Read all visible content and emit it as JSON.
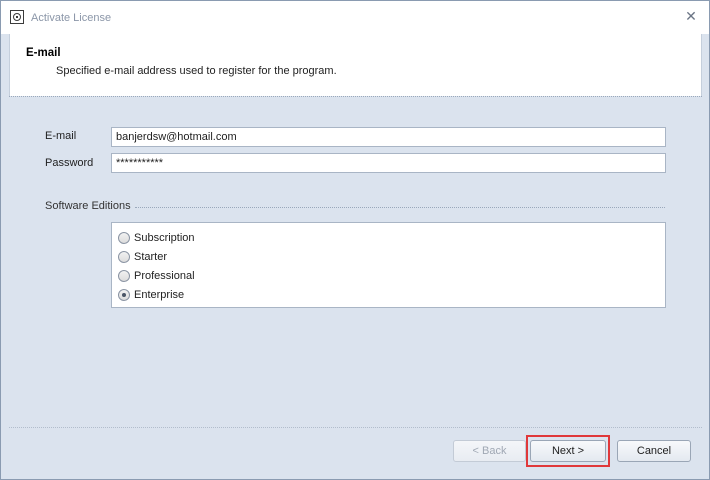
{
  "window": {
    "title": "Activate License",
    "close_glyph": "✕"
  },
  "header": {
    "title": "E-mail",
    "description": "Specified e-mail address used to register for the program."
  },
  "form": {
    "email_label": "E-mail",
    "email_value": "banjerdsw@hotmail.com",
    "password_label": "Password",
    "password_value": "***********"
  },
  "editions": {
    "label": "Software Editions",
    "options": [
      {
        "label": "Subscription",
        "checked": false
      },
      {
        "label": "Starter",
        "checked": false
      },
      {
        "label": "Professional",
        "checked": false
      },
      {
        "label": "Enterprise",
        "checked": true
      }
    ]
  },
  "buttons": {
    "back": "< Back",
    "next": "Next >",
    "cancel": "Cancel"
  },
  "colors": {
    "highlight": "#e0383a",
    "panel": "#dbe3ee"
  }
}
